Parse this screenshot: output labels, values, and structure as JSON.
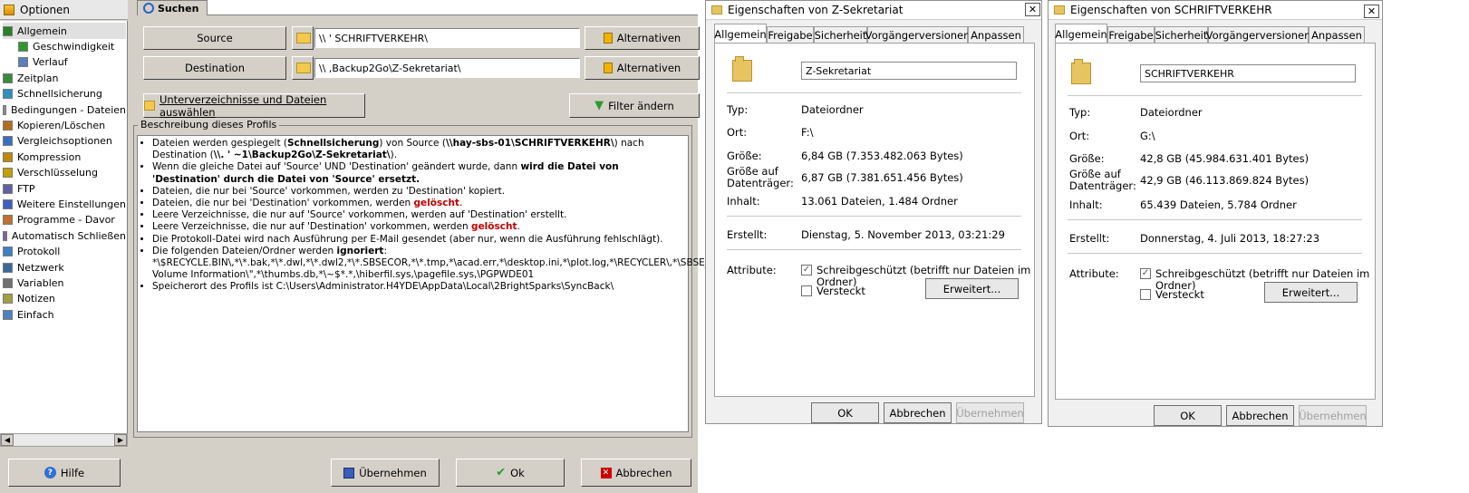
{
  "syncback": {
    "sidebar_title": "Optionen",
    "tree": [
      {
        "label": "Allgemein",
        "icon": "checkmark-icon",
        "selected": true,
        "indent": 0
      },
      {
        "label": "Geschwindigkeit",
        "icon": "bar-chart-icon",
        "indent": 1
      },
      {
        "label": "Verlauf",
        "icon": "grid-icon",
        "indent": 1
      },
      {
        "label": "Zeitplan",
        "icon": "calendar-icon",
        "indent": 0
      },
      {
        "label": "Schnellsicherung",
        "icon": "fast-backup-icon",
        "indent": 0
      },
      {
        "label": "Bedingungen - Dateien",
        "icon": "filter-icon",
        "indent": 0
      },
      {
        "label": "Kopieren/Löschen",
        "icon": "copy-icon",
        "indent": 0
      },
      {
        "label": "Vergleichsoptionen",
        "icon": "compare-icon",
        "indent": 0
      },
      {
        "label": "Kompression",
        "icon": "compress-icon",
        "indent": 0
      },
      {
        "label": "Verschlüsselung",
        "icon": "lock-icon",
        "indent": 0
      },
      {
        "label": "FTP",
        "icon": "ftp-icon",
        "indent": 0
      },
      {
        "label": "Weitere Einstellungen",
        "icon": "settings-icon",
        "indent": 0
      },
      {
        "label": "Programme - Davor",
        "icon": "program-icon",
        "indent": 0
      },
      {
        "label": "Automatisch Schließen",
        "icon": "auto-close-icon",
        "indent": 0
      },
      {
        "label": "Protokoll",
        "icon": "log-icon",
        "indent": 0
      },
      {
        "label": "Netzwerk",
        "icon": "network-icon",
        "indent": 0
      },
      {
        "label": "Variablen",
        "icon": "variables-icon",
        "indent": 0
      },
      {
        "label": "Notizen",
        "icon": "notes-icon",
        "indent": 0
      },
      {
        "label": "Einfach",
        "icon": "simple-icon",
        "indent": 0
      }
    ],
    "tab_label": "Suchen",
    "source_label": "Source",
    "source_value": "\\\\                 ' SCHRIFTVERKEHR\\",
    "destination_label": "Destination",
    "destination_value": "\\\\                  ,Backup2Go\\Z-Sekretariat\\",
    "alt_label": "Alternativen",
    "subdirs_label": "Unterverzeichnisse und Dateien auswählen",
    "filter_label": "Filter ändern",
    "desc_title": "Beschreibung dieses Profils",
    "desc_items": [
      "Dateien werden gespiegelt (<b>Schnellsicherung</b>) von Source (<b>\\\\hay-sbs-01\\SCHRIFTVERKEHR\\</b>) nach Destination (<b>\\\\.      ' ~1\\Backup2Go\\Z-Sekretariat\\</b>).",
      "Wenn die gleiche Datei auf 'Source' UND 'Destination' geändert wurde, dann <b>wird die Datei von 'Destination' durch die Datei von 'Source' ersetzt.</b>",
      "Dateien, die nur bei 'Source' vorkommen, werden zu 'Destination' kopiert.",
      "Dateien, die nur bei 'Destination' vorkommen, werden <span class=\"red\">gelöscht</span>.",
      "Leere Verzeichnisse, die nur auf 'Source' vorkommen, werden auf 'Destination' erstellt.",
      "Leere Verzeichnisse, die nur auf 'Destination' vorkommen, werden <span class=\"red\">gelöscht</span>.",
      "Die Protokoll-Datei wird nach Ausführung per E-Mail gesendet (aber nur, wenn die Ausführung fehlschlägt).",
      "Die folgenden Dateien/Ordner werden <b>ignoriert</b>: *\\$RECYCLE.BIN\\,*\\*.bak,*\\*.dwl,*\\*.dwl2,*\\*.SBSECOR,*\\*.tmp,*\\acad.err,*\\desktop.ini,*\\plot.log,*\\RECYCLER\\,*\\SBSE____.*,\"*\\System Volume Information\\\",*\\thumbs.db,*\\~$*.*,\\hiberfil.sys,\\pagefile.sys,\\PGPWDE01",
      "Speicherort des Profils ist C:\\Users\\Administrator.H4YDE\\AppData\\Local\\2BrightSparks\\SyncBack\\"
    ],
    "help_label": "Hilfe",
    "apply_label": "Übernehmen",
    "ok_label": "Ok",
    "cancel_label": "Abbrechen"
  },
  "dialog1": {
    "title": "Eigenschaften von Z-Sekretariat",
    "tabs": [
      "Allgemein",
      "Freigabe",
      "Sicherheit",
      "Vorgängerversionen",
      "Anpassen"
    ],
    "name_value": "Z-Sekretariat",
    "typ_label": "Typ:",
    "typ_value": "Dateiordner",
    "ort_label": "Ort:",
    "ort_value": "F:\\",
    "groesse_label": "Größe:",
    "groesse_value": "6,84 GB (7.353.482.063 Bytes)",
    "gad_label_1": "Größe auf",
    "gad_label_2": "Datenträger:",
    "gad_value": "6,87 GB (7.381.651.456 Bytes)",
    "inhalt_label": "Inhalt:",
    "inhalt_value": "13.061 Dateien, 1.484 Ordner",
    "erstellt_label": "Erstellt:",
    "erstellt_value": "Dienstag, 5. November 2013, 03:21:29",
    "attribute_label": "Attribute:",
    "readonly_label": "Schreibgeschützt (betrifft nur Dateien im Ordner)",
    "hidden_label": "Versteckt",
    "advanced_label": "Erweitert...",
    "ok_label": "OK",
    "cancel_label": "Abbrechen",
    "apply_label": "Übernehmen"
  },
  "dialog2": {
    "title": "Eigenschaften von SCHRIFTVERKEHR",
    "tabs": [
      "Allgemein",
      "Freigabe",
      "Sicherheit",
      "Vorgängerversionen",
      "Anpassen"
    ],
    "name_value": "SCHRIFTVERKEHR",
    "typ_label": "Typ:",
    "typ_value": "Dateiordner",
    "ort_label": "Ort:",
    "ort_value": "G:\\",
    "groesse_label": "Größe:",
    "groesse_value": "42,8 GB (45.984.631.401 Bytes)",
    "gad_label_1": "Größe auf",
    "gad_label_2": "Datenträger:",
    "gad_value": "42,9 GB (46.113.869.824 Bytes)",
    "inhalt_label": "Inhalt:",
    "inhalt_value": "65.439 Dateien, 5.784 Ordner",
    "erstellt_label": "Erstellt:",
    "erstellt_value": "Donnerstag, 4. Juli 2013, 18:27:23",
    "attribute_label": "Attribute:",
    "readonly_label": "Schreibgeschützt (betrifft nur Dateien im Ordner)",
    "hidden_label": "Versteckt",
    "advanced_label": "Erweitert...",
    "ok_label": "OK",
    "cancel_label": "Abbrechen",
    "apply_label": "Übernehmen"
  }
}
